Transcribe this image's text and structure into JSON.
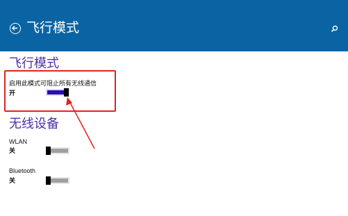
{
  "header": {
    "title": "飞行模式",
    "back_icon": "back-arrow-circle-icon",
    "search_icon": "search-icon",
    "background": "#0a64a4"
  },
  "airplane": {
    "heading": "飞行模式",
    "description": "启用此模式可阻止所有无线通信",
    "state": "开",
    "toggle_on": true
  },
  "wireless": {
    "heading": "无线设备",
    "items": [
      {
        "label": "WLAN",
        "state": "关",
        "toggle_on": false
      },
      {
        "label": "Bluetooth",
        "state": "关",
        "toggle_on": false
      }
    ]
  },
  "colors": {
    "accent": "#4c2fa8",
    "toggle_on_fill": "#2b0fa8",
    "annotation_red": "#e2231a"
  }
}
